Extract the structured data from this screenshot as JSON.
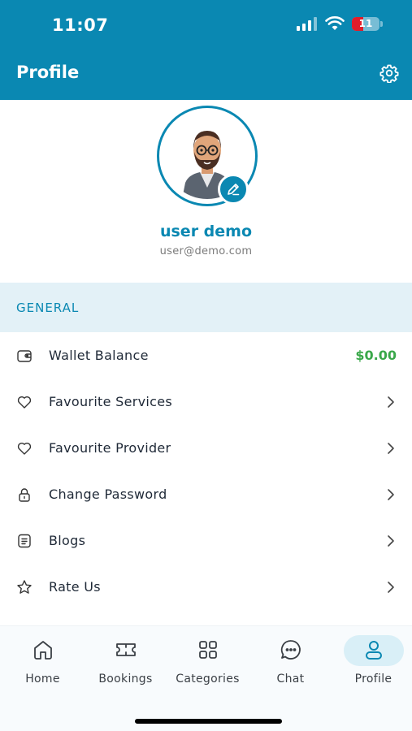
{
  "status_bar": {
    "time": "11:07",
    "battery": "11",
    "battery_level": 0.11
  },
  "header": {
    "title": "Profile",
    "settings_icon": "gear-icon"
  },
  "profile": {
    "name": "user demo",
    "email": "user@demo.com",
    "edit_icon": "pencil-icon"
  },
  "section": {
    "title": "GENERAL"
  },
  "menu": {
    "items": [
      {
        "label": "Wallet Balance",
        "icon": "wallet-icon",
        "value": "$0.00"
      },
      {
        "label": "Favourite Services",
        "icon": "heart-icon"
      },
      {
        "label": "Favourite Provider",
        "icon": "heart-icon"
      },
      {
        "label": "Change Password",
        "icon": "lock-icon"
      },
      {
        "label": "Blogs",
        "icon": "document-icon"
      },
      {
        "label": "Rate Us",
        "icon": "star-icon"
      }
    ]
  },
  "nav": {
    "items": [
      {
        "label": "Home",
        "icon": "home-icon"
      },
      {
        "label": "Bookings",
        "icon": "ticket-icon"
      },
      {
        "label": "Categories",
        "icon": "grid-icon"
      },
      {
        "label": "Chat",
        "icon": "chat-icon"
      },
      {
        "label": "Profile",
        "icon": "user-icon",
        "active": true
      }
    ]
  },
  "colors": {
    "primary": "#0a88b2",
    "section_bg": "#e3f1f7",
    "wallet_value": "#3aa84a",
    "battery_low": "#e11d2a"
  }
}
